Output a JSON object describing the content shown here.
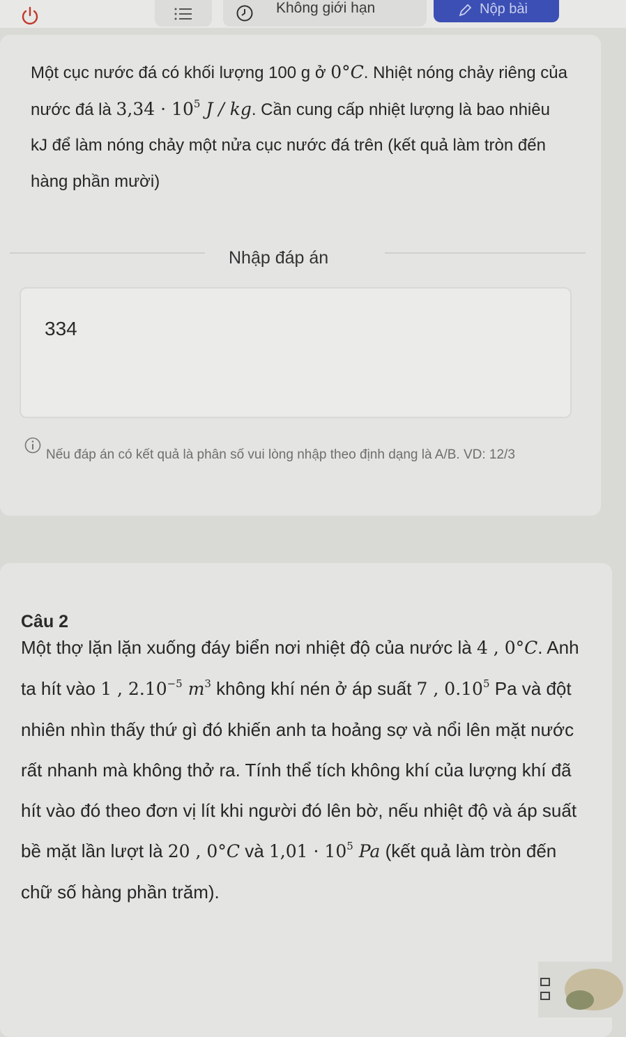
{
  "header": {
    "timer_text": "Không giới hạn",
    "submit_label": "Nộp bài",
    "icons": [
      "power-icon",
      "list-icon",
      "clock-icon",
      "pencil-icon"
    ],
    "colors": {
      "submit": "#3c4fb4"
    }
  },
  "question1": {
    "text_1": "Một cục nước đá có khối lượng 100 g ở ",
    "temp_value": "0",
    "temp_unit": "°C",
    "text_2": ". Nhiệt nóng chảy riêng của nước đá là ",
    "latent_mantissa": "3,34 · 10",
    "latent_exp": "5",
    "latent_unit": " J / kg",
    "text_3": ". Cần cung cấp nhiệt lượng là bao nhiêu kJ để làm nóng chảy một nửa cục nước đá trên (kết quả làm tròn đến hàng phần mười)",
    "answer_label": "Nhập đáp án",
    "answer_value": "334",
    "hint": "Nếu đáp án có kết quả là phân số vui lòng nhập theo định dạng là A/B. VD: 12/3"
  },
  "question2": {
    "title": "Câu 2",
    "text_1": "Một thợ lặn lặn xuống đáy biển nơi nhiệt độ của nước là ",
    "temp1": "4 , 0",
    "temp1_unit": "°C",
    "text_2": ". Anh ta hít vào ",
    "volume_mantissa": "1 , 2.10",
    "volume_exp": "−5",
    "volume_unit": "m",
    "volume_unit_exp": "3",
    "text_3": " không khí nén ở áp suất ",
    "pressure_mantissa": "7 , 0.10",
    "pressure_exp": "5",
    "text_4": " Pa và đột nhiên nhìn thấy thứ gì đó khiến anh ta hoảng sợ và nổi lên mặt nước rất nhanh mà không thở ra. Tính thể tích không khí của lượng khí đã hít vào đó theo đơn vị lít khi người đó lên bờ, nếu nhiệt độ và áp suất bề mặt lần lượt là ",
    "temp2": "20 , 0",
    "temp2_unit": "°C",
    "text_5": " và ",
    "pressure2_mantissa": "1,01 · 10",
    "pressure2_exp": "5",
    "pressure2_unit": " Pa",
    "text_6": " (kết quả làm tròn đến chữ số hàng phần trăm)."
  }
}
